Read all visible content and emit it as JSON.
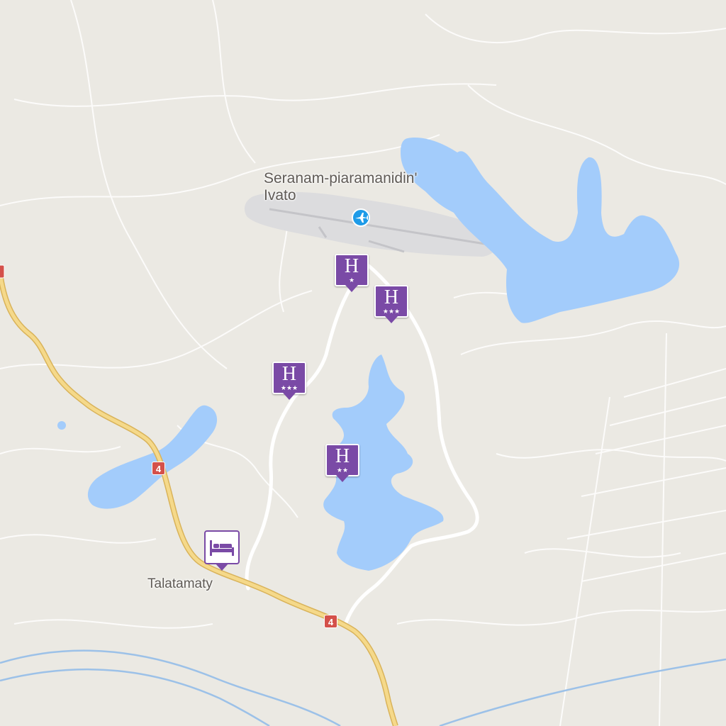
{
  "map": {
    "colors": {
      "land": "#ebe9e3",
      "water": "#a3ccfb",
      "minor_road": "#ffffff",
      "highway": "#f5d98a",
      "highway_edge": "#d9b35a",
      "airport_area": "#dcdcde",
      "hotel_marker": "#7a4aa6"
    },
    "labels": {
      "airport_line1": "Seranam-piaramanidin'",
      "airport_line2": "Ivato",
      "town": "Talatamaty"
    },
    "road_shields": [
      {
        "ref": "4"
      },
      {
        "ref": "4"
      }
    ],
    "hotels": [
      {
        "letter": "H",
        "stars": "★"
      },
      {
        "letter": "H",
        "stars": "★★★"
      },
      {
        "letter": "H",
        "stars": "★★★"
      },
      {
        "letter": "H",
        "stars": "★★"
      }
    ],
    "icons": {
      "airport": "airplane-icon",
      "hotel": "hotel-icon",
      "lodging": "bed-icon"
    }
  }
}
